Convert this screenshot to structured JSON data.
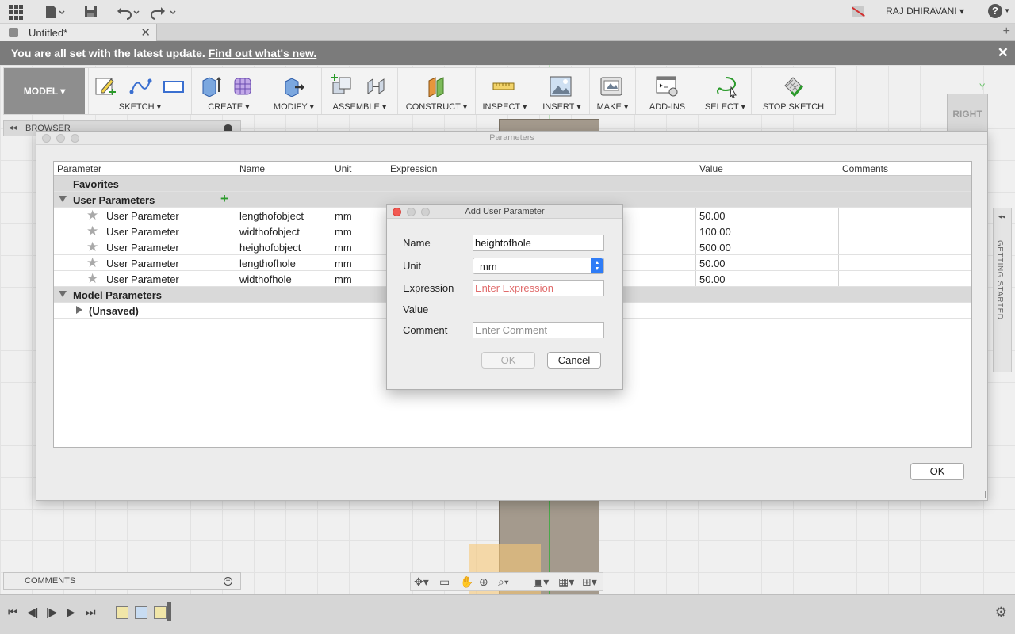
{
  "app": {
    "user_name": "RAJ DHIRAVANI",
    "help_label": "?"
  },
  "tab": {
    "title": "Untitled*"
  },
  "banner": {
    "message": "You are all set with the latest update.",
    "link": "Find out what's new."
  },
  "toolbar": {
    "model_label": "MODEL",
    "groups": [
      {
        "label": "SKETCH"
      },
      {
        "label": "CREATE"
      },
      {
        "label": "MODIFY"
      },
      {
        "label": "ASSEMBLE"
      },
      {
        "label": "CONSTRUCT"
      },
      {
        "label": "INSPECT"
      },
      {
        "label": "INSERT"
      },
      {
        "label": "MAKE"
      },
      {
        "label": "ADD-INS"
      },
      {
        "label": "SELECT"
      },
      {
        "label": "STOP SKETCH"
      }
    ]
  },
  "viewcube": {
    "face": "RIGHT",
    "axis": "Y"
  },
  "browser": {
    "title": "BROWSER"
  },
  "getting_started": {
    "label": "GETTING STARTED"
  },
  "parameters": {
    "title": "Parameters",
    "columns": [
      "Parameter",
      "Name",
      "Unit",
      "Expression",
      "Value",
      "Comments"
    ],
    "favorites_label": "Favorites",
    "user_params_label": "User Parameters",
    "model_params_label": "Model Parameters",
    "unsaved_label": "(Unsaved)",
    "rows": [
      {
        "parameter": "User Parameter",
        "name": "lengthofobject",
        "unit": "mm",
        "value": "50.00"
      },
      {
        "parameter": "User Parameter",
        "name": "widthofobject",
        "unit": "mm",
        "value": "100.00"
      },
      {
        "parameter": "User Parameter",
        "name": "heighofobject",
        "unit": "mm",
        "value": "500.00"
      },
      {
        "parameter": "User Parameter",
        "name": "lengthofhole",
        "unit": "mm",
        "value": "50.00"
      },
      {
        "parameter": "User Parameter",
        "name": "widthofhole",
        "unit": "mm",
        "value": "50.00"
      }
    ],
    "ok_label": "OK"
  },
  "add_param": {
    "title": "Add User Parameter",
    "name_label": "Name",
    "name_value": "heightofhole",
    "unit_label": "Unit",
    "unit_value": "mm",
    "expression_label": "Expression",
    "expression_placeholder": "Enter Expression",
    "value_label": "Value",
    "comment_label": "Comment",
    "comment_placeholder": "Enter Comment",
    "ok_label": "OK",
    "cancel_label": "Cancel"
  },
  "comments": {
    "title": "COMMENTS"
  },
  "colors": {
    "accent_blue": "#2f7cf6",
    "close_red": "#f25a53",
    "add_green": "#2a9a2a",
    "banner_gray": "#7b7b7b"
  }
}
